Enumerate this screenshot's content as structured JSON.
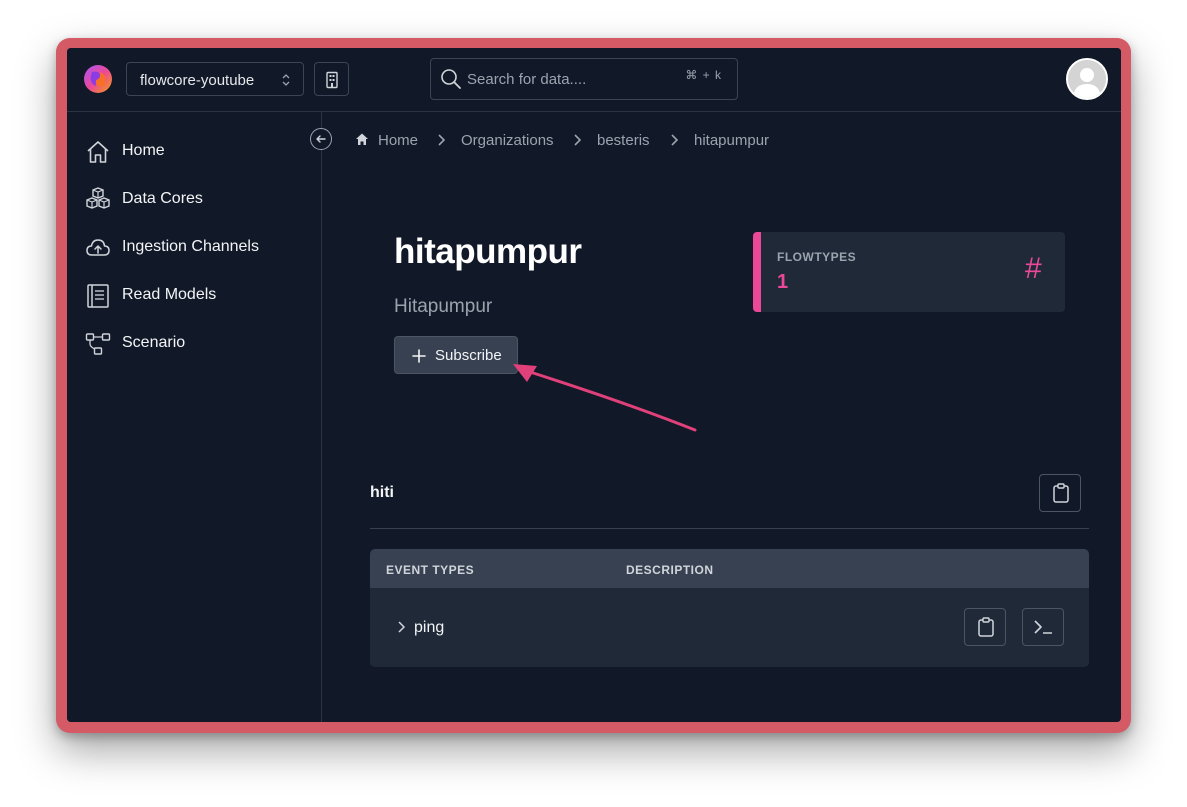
{
  "header": {
    "organization": "flowcore-youtube",
    "search_placeholder": "Search for data....",
    "search_shortcut": "⌘ + k"
  },
  "sidebar": {
    "items": [
      {
        "label": "Home",
        "icon": "home-icon"
      },
      {
        "label": "Data Cores",
        "icon": "cubes-icon"
      },
      {
        "label": "Ingestion Channels",
        "icon": "cloud-upload-icon"
      },
      {
        "label": "Read Models",
        "icon": "book-icon"
      },
      {
        "label": "Scenario",
        "icon": "flow-icon"
      }
    ]
  },
  "breadcrumb": [
    "Home",
    "Organizations",
    "besteris",
    "hitapumpur"
  ],
  "main": {
    "title": "hitapumpur",
    "subtitle": "Hitapumpur",
    "subscribe_label": "Subscribe",
    "stat": {
      "label": "FLOWTYPES",
      "value": "1",
      "symbol": "#"
    },
    "flowtype": {
      "name": "hiti",
      "columns": [
        "EVENT TYPES",
        "DESCRIPTION"
      ],
      "rows": [
        {
          "name": "ping",
          "description": ""
        }
      ]
    }
  },
  "colors": {
    "background": "#111827",
    "panel": "#1f2937",
    "accent": "#ec4899",
    "frame": "#d45a66"
  }
}
